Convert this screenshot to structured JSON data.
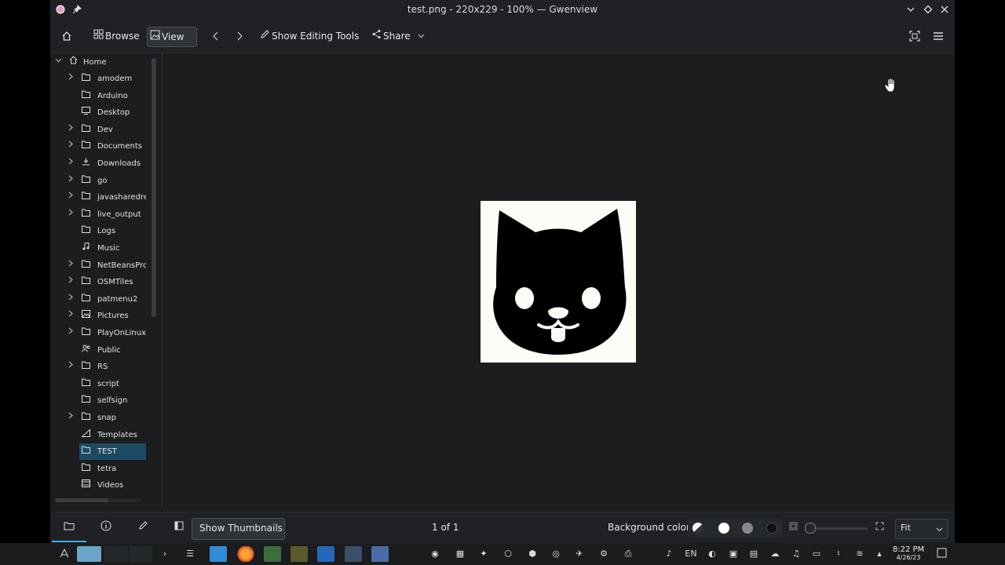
{
  "window": {
    "title": "test.png - 220x229 - 100% — Gwenview"
  },
  "toolbar": {
    "browse": "Browse",
    "view": "View",
    "show_editing_tools": "Show Editing Tools",
    "share": "Share"
  },
  "sidebar": {
    "root": "Home",
    "items": [
      {
        "label": "amodem",
        "expandable": true,
        "icon": "folder-icon"
      },
      {
        "label": "Arduino",
        "expandable": false,
        "icon": "folder-icon"
      },
      {
        "label": "Desktop",
        "expandable": false,
        "icon": "desktop-icon"
      },
      {
        "label": "Dev",
        "expandable": true,
        "icon": "folder-icon"
      },
      {
        "label": "Documents",
        "expandable": true,
        "icon": "folder-icon"
      },
      {
        "label": "Downloads",
        "expandable": true,
        "icon": "download-icon"
      },
      {
        "label": "go",
        "expandable": true,
        "icon": "folder-icon"
      },
      {
        "label": "javasharedre",
        "expandable": true,
        "icon": "folder-icon"
      },
      {
        "label": "live_output",
        "expandable": true,
        "icon": "folder-icon"
      },
      {
        "label": "Logs",
        "expandable": false,
        "icon": "folder-icon"
      },
      {
        "label": "Music",
        "expandable": false,
        "icon": "music-icon"
      },
      {
        "label": "NetBeansPro",
        "expandable": true,
        "icon": "folder-icon"
      },
      {
        "label": "OSMTiles",
        "expandable": true,
        "icon": "folder-icon"
      },
      {
        "label": "patmenu2",
        "expandable": true,
        "icon": "folder-icon"
      },
      {
        "label": "Pictures",
        "expandable": true,
        "icon": "pictures-icon"
      },
      {
        "label": "PlayOnLinux'",
        "expandable": true,
        "icon": "folder-icon"
      },
      {
        "label": "Public",
        "expandable": false,
        "icon": "public-icon"
      },
      {
        "label": "RS",
        "expandable": true,
        "icon": "folder-icon"
      },
      {
        "label": "script",
        "expandable": false,
        "icon": "folder-icon"
      },
      {
        "label": "selfsign",
        "expandable": false,
        "icon": "folder-icon"
      },
      {
        "label": "snap",
        "expandable": true,
        "icon": "folder-icon"
      },
      {
        "label": "Templates",
        "expandable": false,
        "icon": "templates-icon"
      },
      {
        "label": "TEST",
        "expandable": false,
        "icon": "folder-icon",
        "selected": true
      },
      {
        "label": "tetra",
        "expandable": false,
        "icon": "folder-icon"
      },
      {
        "label": "Videos",
        "expandable": false,
        "icon": "videos-icon"
      }
    ]
  },
  "bottom": {
    "show_thumbnails": "Show Thumbnails",
    "page_counter": "1 of 1",
    "background_color_label": "Background color:",
    "zoom": "Fit"
  },
  "taskbar": {
    "language": "EN",
    "time": "8:22 PM",
    "date": "4/26/23"
  },
  "colors": {
    "accent": "#3daee9",
    "selection": "#1d4a63",
    "background": "#1b1d1f"
  }
}
